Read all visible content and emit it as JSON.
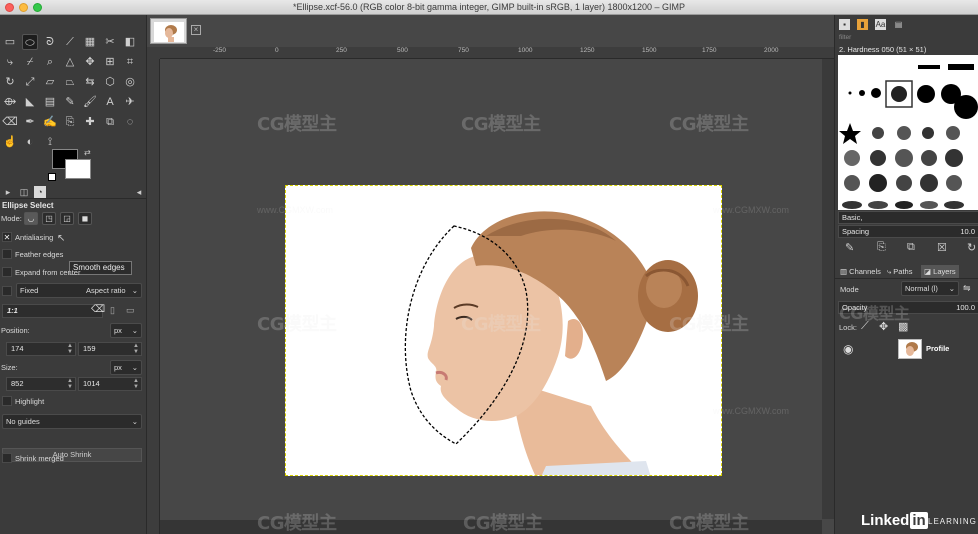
{
  "window": {
    "title": "*Ellipse.xcf-56.0 (RGB color 8-bit gamma integer, GIMP built-in sRGB, 1 layer) 1800x1200 – GIMP"
  },
  "tool_options": {
    "panel_title": "Ellipse Select",
    "mode_label": "Mode:",
    "antialiasing_label": "Antialiasing",
    "feather_label": "Feather edges",
    "tooltip": "Smooth edges",
    "expand_label": "Expand from center",
    "fixed_label": "Fixed",
    "aspect_option": "Aspect ratio",
    "ratio_value": "1:1",
    "position_label": "Position:",
    "position_unit": "px",
    "pos_x": "174",
    "pos_y": "159",
    "size_label": "Size:",
    "size_unit": "px",
    "size_w": "852",
    "size_h": "1014",
    "highlight_label": "Highlight",
    "guides_option": "No guides",
    "auto_shrink": "Auto Shrink",
    "shrink_merged": "Shrink merged"
  },
  "rulers": {
    "h": [
      "-250",
      "0",
      "250",
      "500",
      "750",
      "1000",
      "1250",
      "1500",
      "1750",
      "2000"
    ]
  },
  "dock": {
    "filter_placeholder": "filter",
    "brush_name": "2. Hardness 050 (51 × 51)",
    "preset": "Basic,",
    "spacing_label": "Spacing",
    "spacing_value": "10.0",
    "tabs": {
      "channels": "Channels",
      "paths": "Paths",
      "layers": "Layers"
    },
    "mode_label": "Mode",
    "mode_value": "Normal (l)",
    "opacity_label": "Opacity",
    "opacity_value": "100.0",
    "lock_label": "Lock:",
    "layer_name": "Profile"
  },
  "watermark": {
    "brand": "CG模型主",
    "url": "www.CGMXW.com"
  },
  "branding": {
    "linked": "Linked",
    "in": "in",
    "learning": "LEARNING"
  },
  "colors": {
    "selection_marquee": "#d9d200",
    "foreground": "#000000",
    "background": "#ffffff"
  }
}
